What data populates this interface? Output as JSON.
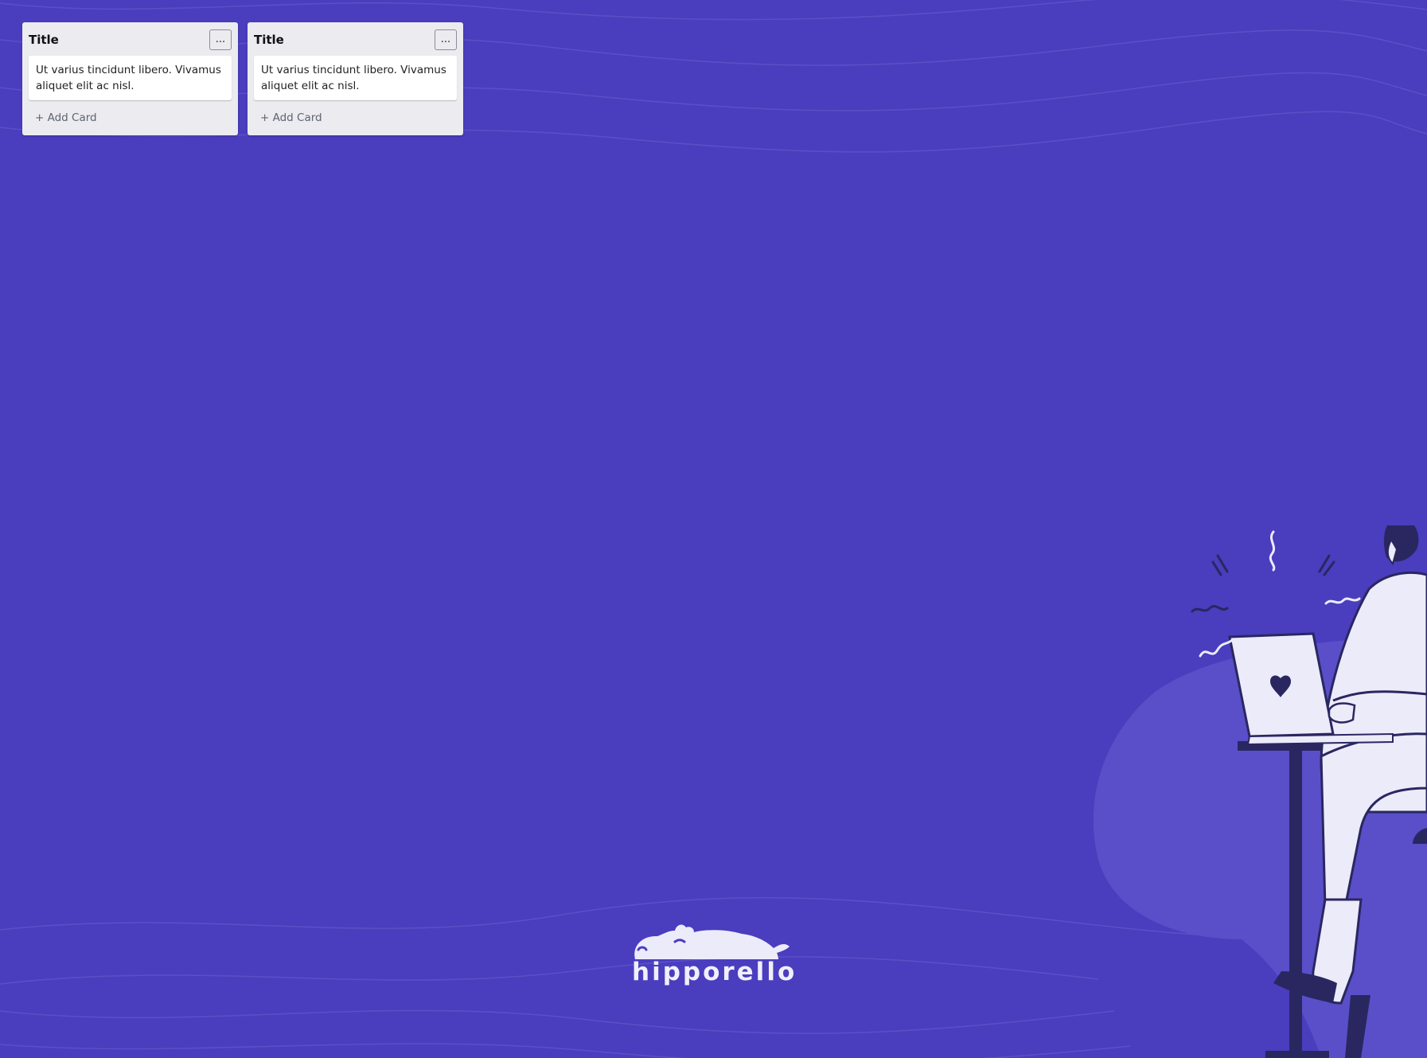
{
  "board": {
    "lists": [
      {
        "title": "Title",
        "menu_label": "...",
        "cards": [
          "Ut varius tincidunt libero. Vivamus aliquet elit ac nisl."
        ],
        "add_card_label": "+ Add Card"
      },
      {
        "title": "Title",
        "menu_label": "...",
        "cards": [
          "Ut varius tincidunt libero. Vivamus aliquet elit ac nisl."
        ],
        "add_card_label": "+ Add Card"
      }
    ]
  },
  "logo": {
    "text": "hipporello"
  },
  "colors": {
    "background": "#4a3dbe",
    "list_background": "#ebebf0",
    "card_background": "#ffffff",
    "illustration_light": "#ecebfa",
    "illustration_dark": "#2a2760",
    "blob": "#5a4fc9"
  },
  "icons": [
    "hippo-logo-icon",
    "person-at-laptop-illustration",
    "heart-icon"
  ]
}
